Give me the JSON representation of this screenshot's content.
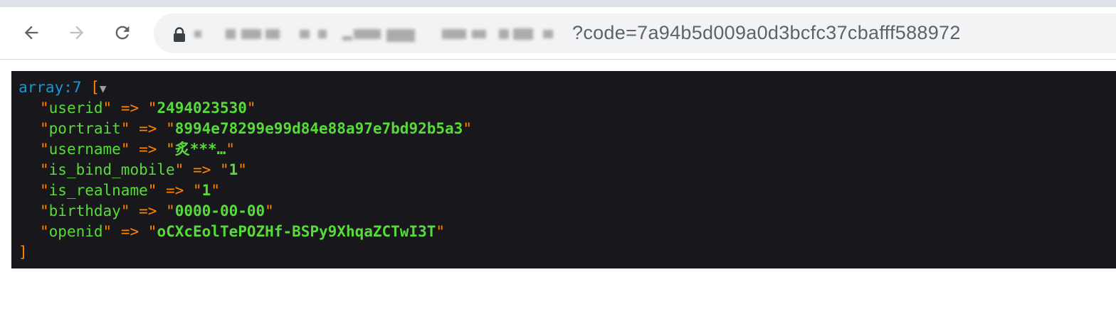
{
  "browser": {
    "url_visible_suffix": "?code=7a94b5d009a0d3bcfc37cbafff588972",
    "icons": {
      "back": "back-arrow-icon",
      "forward": "forward-arrow-icon",
      "reload": "reload-icon",
      "lock": "lock-icon"
    }
  },
  "dump": {
    "type_label": "array:7",
    "open_bracket": "[",
    "toggle_glyph": "▼",
    "close_bracket": "]",
    "arrow": "=>",
    "entries": [
      {
        "key": "userid",
        "value": "2494023530"
      },
      {
        "key": "portrait",
        "value": "8994e78299e99d84e88a97e7bd92b5a3"
      },
      {
        "key": "username",
        "value": "炙***…"
      },
      {
        "key": "is_bind_mobile",
        "value": "1"
      },
      {
        "key": "is_realname",
        "value": "1"
      },
      {
        "key": "birthday",
        "value": "0000-00-00"
      },
      {
        "key": "openid",
        "value": "oCXcEolTePOZHf-BSPy9XhqaZCTwI3T"
      }
    ]
  },
  "colors": {
    "dump_background": "#18171b",
    "type_label": "#1299da",
    "punctuation": "#ff8400",
    "string": "#56db3a"
  }
}
